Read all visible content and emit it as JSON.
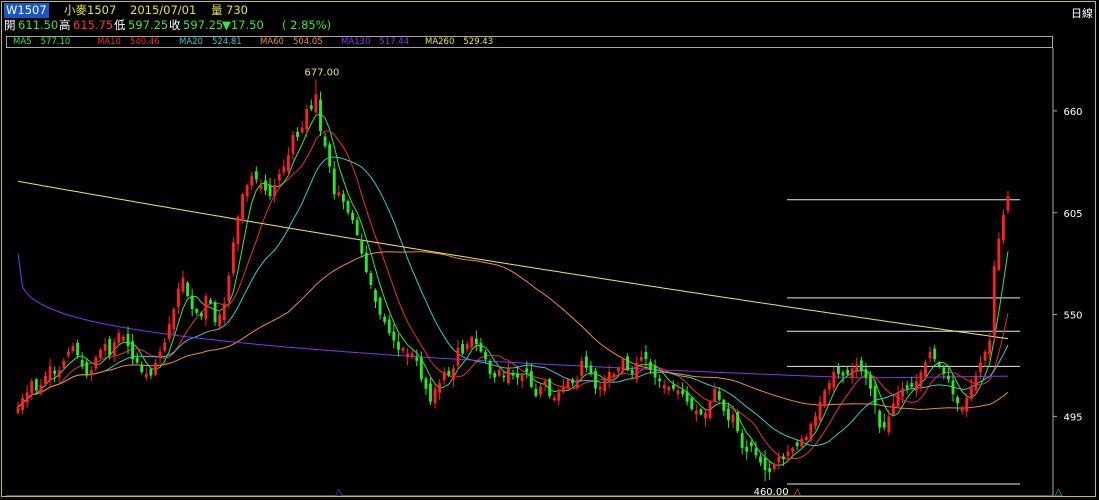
{
  "header": {
    "symbol": "W1507",
    "name": "小麥1507",
    "date": "2015/07/01",
    "volume_label": "量",
    "volume_value": "730",
    "open_label": "開",
    "open_value": "611.50",
    "high_label": "高",
    "high_value": "615.75",
    "low_label": "低",
    "low_value": "597.25",
    "close_label": "收",
    "close_value": "597.25",
    "change": "▼17.50",
    "change_pct": "( 2.85%)",
    "period": "日線"
  },
  "ma_bar": [
    {
      "label": "MA5",
      "value": "577.10",
      "color": "#39e839"
    },
    {
      "label": "MA10",
      "value": "540.46",
      "color": "#e83030"
    },
    {
      "label": "MA20",
      "value": "524.81",
      "color": "#33cccc"
    },
    {
      "label": "MA60",
      "value": "504.05",
      "color": "#f08a30"
    },
    {
      "label": "MA130",
      "value": "517.44",
      "color": "#8833ee"
    },
    {
      "label": "MA260",
      "value": "529.43",
      "color": "#e8e830"
    }
  ],
  "colors": {
    "up": "#ff2020",
    "down": "#22ee22",
    "ma5": "#39e839",
    "ma10": "#e83030",
    "ma20": "#33cccc",
    "ma60": "#f08a30",
    "ma130": "#8833ee",
    "ma260": "#e8e860",
    "frame": "#c8c800"
  },
  "chart_data": {
    "type": "candlestick",
    "y_ticks": [
      "660",
      "605",
      "550",
      "495"
    ],
    "ylim": [
      452,
      694
    ],
    "high_annotation": "677.00",
    "low_annotation": "460.00",
    "horizontal_levels": [
      612,
      559,
      541,
      522
    ],
    "markers": [
      {
        "index": 70,
        "symbol": "△",
        "color": "#5555ff"
      },
      {
        "index": 170,
        "symbol": "△",
        "color": "#f08a30"
      },
      {
        "index": 227,
        "symbol": "△",
        "color": "#33cccc"
      },
      {
        "index": 241,
        "symbol": "△",
        "color": "#e83030"
      },
      {
        "index": 247,
        "symbol": "△",
        "color": "#39e839"
      }
    ],
    "closes": [
      500,
      505,
      508,
      514,
      509,
      512,
      517,
      522,
      518,
      520,
      525,
      530,
      533,
      528,
      522,
      517,
      520,
      527,
      531,
      534,
      528,
      535,
      540,
      538,
      533,
      526,
      524,
      519,
      518,
      517,
      524,
      530,
      535,
      545,
      553,
      564,
      570,
      560,
      553,
      551,
      549,
      560,
      556,
      546,
      550,
      556,
      571,
      589,
      603,
      615,
      620,
      625,
      623,
      620,
      617,
      614,
      620,
      626,
      630,
      636,
      647,
      646,
      651,
      661,
      661,
      669,
      649,
      641,
      630,
      615,
      616,
      611,
      605,
      601,
      593,
      583,
      573,
      566,
      557,
      550,
      546,
      540,
      536,
      531,
      532,
      529,
      529,
      525,
      515,
      510,
      503,
      510,
      513,
      519,
      517,
      521,
      532,
      529,
      534,
      538,
      534,
      530,
      526,
      518,
      516,
      520,
      516,
      521,
      517,
      516,
      518,
      519,
      511,
      506,
      511,
      514,
      506,
      505,
      508,
      511,
      515,
      513,
      515,
      525,
      521,
      518,
      510,
      511,
      515,
      519,
      518,
      521,
      526,
      520,
      518,
      524,
      527,
      526,
      520,
      516,
      514,
      512,
      511,
      510,
      509,
      507,
      503,
      499,
      498,
      496,
      497,
      503,
      510,
      504,
      498,
      493,
      496,
      487,
      478,
      476,
      479,
      474,
      470,
      466,
      465,
      469,
      473,
      472,
      476,
      478,
      479,
      483,
      484,
      491,
      495,
      503,
      509,
      513,
      519,
      518,
      517,
      518,
      521,
      523,
      520,
      516,
      510,
      501,
      489,
      489,
      495,
      502,
      508,
      510,
      510,
      511,
      514,
      519,
      524,
      530,
      526,
      522,
      518,
      515,
      507,
      502,
      500,
      505,
      511,
      517,
      524,
      530,
      536,
      576,
      591,
      604,
      614
    ],
    "ma_series": {
      "ma5": [],
      "ma10": [],
      "ma20": [],
      "ma60": [],
      "ma130": [],
      "ma260": []
    }
  }
}
